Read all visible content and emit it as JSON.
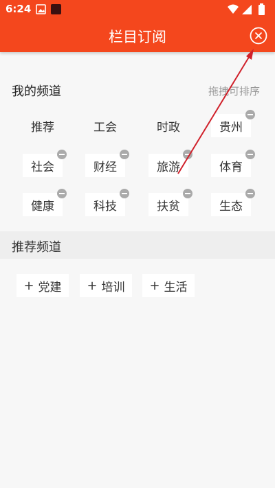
{
  "status_bar": {
    "time": "6:24"
  },
  "app_bar": {
    "title": "栏目订阅",
    "close_icon": "close-circle-icon"
  },
  "my_channels": {
    "title": "我的频道",
    "hint": "拖拽可排序",
    "items": [
      {
        "label": "推荐",
        "removable": false
      },
      {
        "label": "工会",
        "removable": false
      },
      {
        "label": "时政",
        "removable": false
      },
      {
        "label": "贵州",
        "removable": true
      },
      {
        "label": "社会",
        "removable": true
      },
      {
        "label": "财经",
        "removable": true
      },
      {
        "label": "旅游",
        "removable": true
      },
      {
        "label": "体育",
        "removable": true
      },
      {
        "label": "健康",
        "removable": true
      },
      {
        "label": "科技",
        "removable": true
      },
      {
        "label": "扶贫",
        "removable": true
      },
      {
        "label": "生态",
        "removable": true
      }
    ]
  },
  "recommended_channels": {
    "title": "推荐频道",
    "items": [
      {
        "label": "党建"
      },
      {
        "label": "培训"
      },
      {
        "label": "生活"
      }
    ]
  },
  "colors": {
    "accent": "#f4471d",
    "annotation": "#d0202a"
  }
}
